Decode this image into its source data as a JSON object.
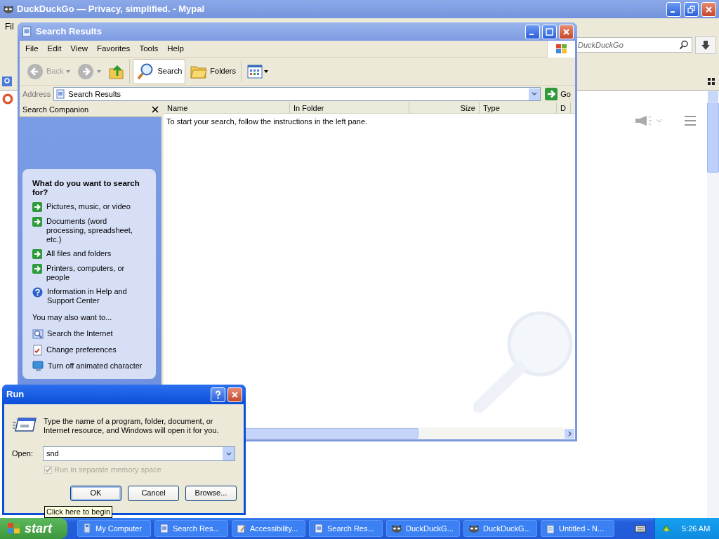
{
  "browser": {
    "title": "DuckDuckGo — Privacy, simplified. - Mypal",
    "menu": [
      "Fil"
    ],
    "search": {
      "placeholder": "DuckDuckGo"
    }
  },
  "explorer": {
    "title": "Search Results",
    "menu": [
      "File",
      "Edit",
      "View",
      "Favorites",
      "Tools",
      "Help"
    ],
    "toolbar": [
      {
        "kind": "back",
        "label": "Back",
        "disabled": true
      },
      {
        "kind": "forward",
        "disabled": true
      },
      {
        "kind": "up",
        "disabled": false
      },
      {
        "kind": "toggle",
        "label": "Search",
        "pressed": true
      },
      {
        "kind": "folders",
        "label": "Folders",
        "pressed": false
      },
      {
        "kind": "views"
      }
    ],
    "address": {
      "label": "Address",
      "value": "Search Results",
      "go": "Go"
    },
    "companion": {
      "title": "Search Companion",
      "question": "What do you want to search for?",
      "links": [
        {
          "kind": "arrow",
          "label": "Pictures, music, or video"
        },
        {
          "kind": "arrow",
          "label": "Documents (word processing, spreadsheet, etc.)"
        },
        {
          "kind": "arrow",
          "label": "All files and folders"
        },
        {
          "kind": "arrow",
          "label": "Printers, computers, or people"
        },
        {
          "kind": "help",
          "label": "Information in Help and Support Center"
        }
      ],
      "also": "You may also want to...",
      "more_links": [
        {
          "kind": "internet",
          "label": "Search the Internet"
        },
        {
          "kind": "prefs",
          "label": "Change preferences"
        },
        {
          "kind": "character",
          "label": "Turn off animated character"
        }
      ]
    },
    "columns": [
      "Name",
      "In Folder",
      "Size",
      "Type",
      "D"
    ],
    "message": "To start your search, follow the instructions in the left pane."
  },
  "run": {
    "title": "Run",
    "text": "Type the name of a program, folder, document, or Internet resource, and Windows will open it for you.",
    "open_label": "Open:",
    "value": "snd",
    "option": {
      "label": "Run in separate memory space",
      "checked": true,
      "disabled": true
    },
    "buttons": [
      {
        "label": "OK",
        "default": true
      },
      {
        "label": "Cancel",
        "default": false
      },
      {
        "label": "Browse...",
        "default": false
      }
    ]
  },
  "tooltip": "Click here to begin",
  "taskbar": {
    "start": "start",
    "items": [
      {
        "kind": "computer",
        "label": "My Computer"
      },
      {
        "kind": "search",
        "label": "Search Res..."
      },
      {
        "kind": "accessibility",
        "label": "Accessibility..."
      },
      {
        "kind": "search",
        "label": "Search Res..."
      },
      {
        "kind": "ddg",
        "label": "DuckDuckG..."
      },
      {
        "kind": "ddg",
        "label": "DuckDuckG..."
      },
      {
        "kind": "notepad",
        "label": "Untitled - N..."
      }
    ],
    "clock": "5:26 AM"
  }
}
